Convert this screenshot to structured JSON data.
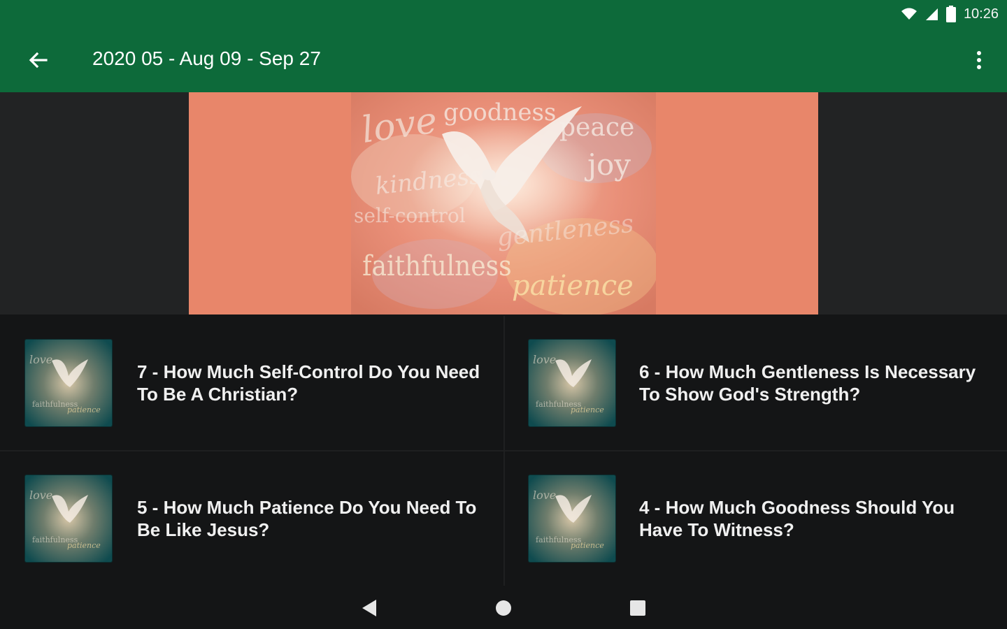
{
  "status_bar": {
    "time": "10:26",
    "icons": [
      "wifi-icon",
      "cell-signal-icon",
      "battery-icon"
    ]
  },
  "app_bar": {
    "title": "2020 05 - Aug 09 - Sep 27",
    "back_icon": "arrow-back-icon",
    "menu_icon": "more-vert-icon",
    "color": "#0d6a3a"
  },
  "hero": {
    "background_color": "#e8866a",
    "image_words": [
      "love",
      "goodness",
      "peace",
      "joy",
      "kindness",
      "self-control",
      "gentleness",
      "faithfulness",
      "patience"
    ]
  },
  "items": [
    {
      "title": "7 - How Much Self-Control Do You Need To Be A Christian?"
    },
    {
      "title": "6 - How Much Gentleness Is Necessary To Show God's Strength?"
    },
    {
      "title": "5 - How Much Patience Do You Need To Be Like Jesus?"
    },
    {
      "title": "4 - How Much Goodness Should You Have To Witness?"
    }
  ],
  "nav_bar": {
    "icons": [
      "nav-back-icon",
      "nav-home-icon",
      "nav-recents-icon"
    ]
  }
}
